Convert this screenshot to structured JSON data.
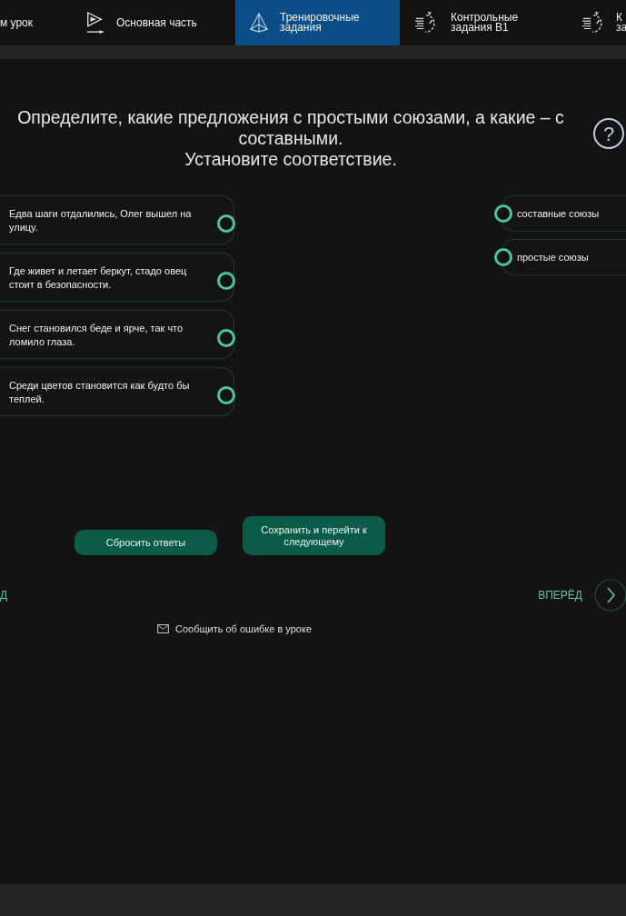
{
  "nav_tabs": [
    {
      "lines": [
        "м урок"
      ],
      "kind": "plain",
      "selected": false
    },
    {
      "lines": [
        "Основная часть"
      ],
      "kind": "video",
      "selected": false
    },
    {
      "lines": [
        "Тренировочные",
        "задания"
      ],
      "kind": "training",
      "selected": true
    },
    {
      "lines": [
        "Контрольные",
        "задания B1"
      ],
      "kind": "test",
      "selected": false
    },
    {
      "lines": [
        "К",
        "за"
      ],
      "kind": "test",
      "selected": false
    }
  ],
  "help_label": "?",
  "question": [
    "Определите, какие предложения с простыми союзами, а какие – с составными.",
    "Установите соответствие."
  ],
  "sentences": [
    "Едва шаги отдалились, Олег вышел на улицу.",
    "Где живет и летает беркут, стадо овец стоит в безопасности.",
    "Снег становился беде и ярче, так что ломило глаза.",
    "Среди цветов становится как будто бы теплей."
  ],
  "answers": [
    "составные союзы",
    "простые союзы"
  ],
  "buttons": [
    "Сбросить ответы",
    "Сохранить и перейти к следующему"
  ],
  "back_label": "Д",
  "forward_label": "ВПЕРЁД",
  "report_link": "Сообщить об ошибке в уроке"
}
